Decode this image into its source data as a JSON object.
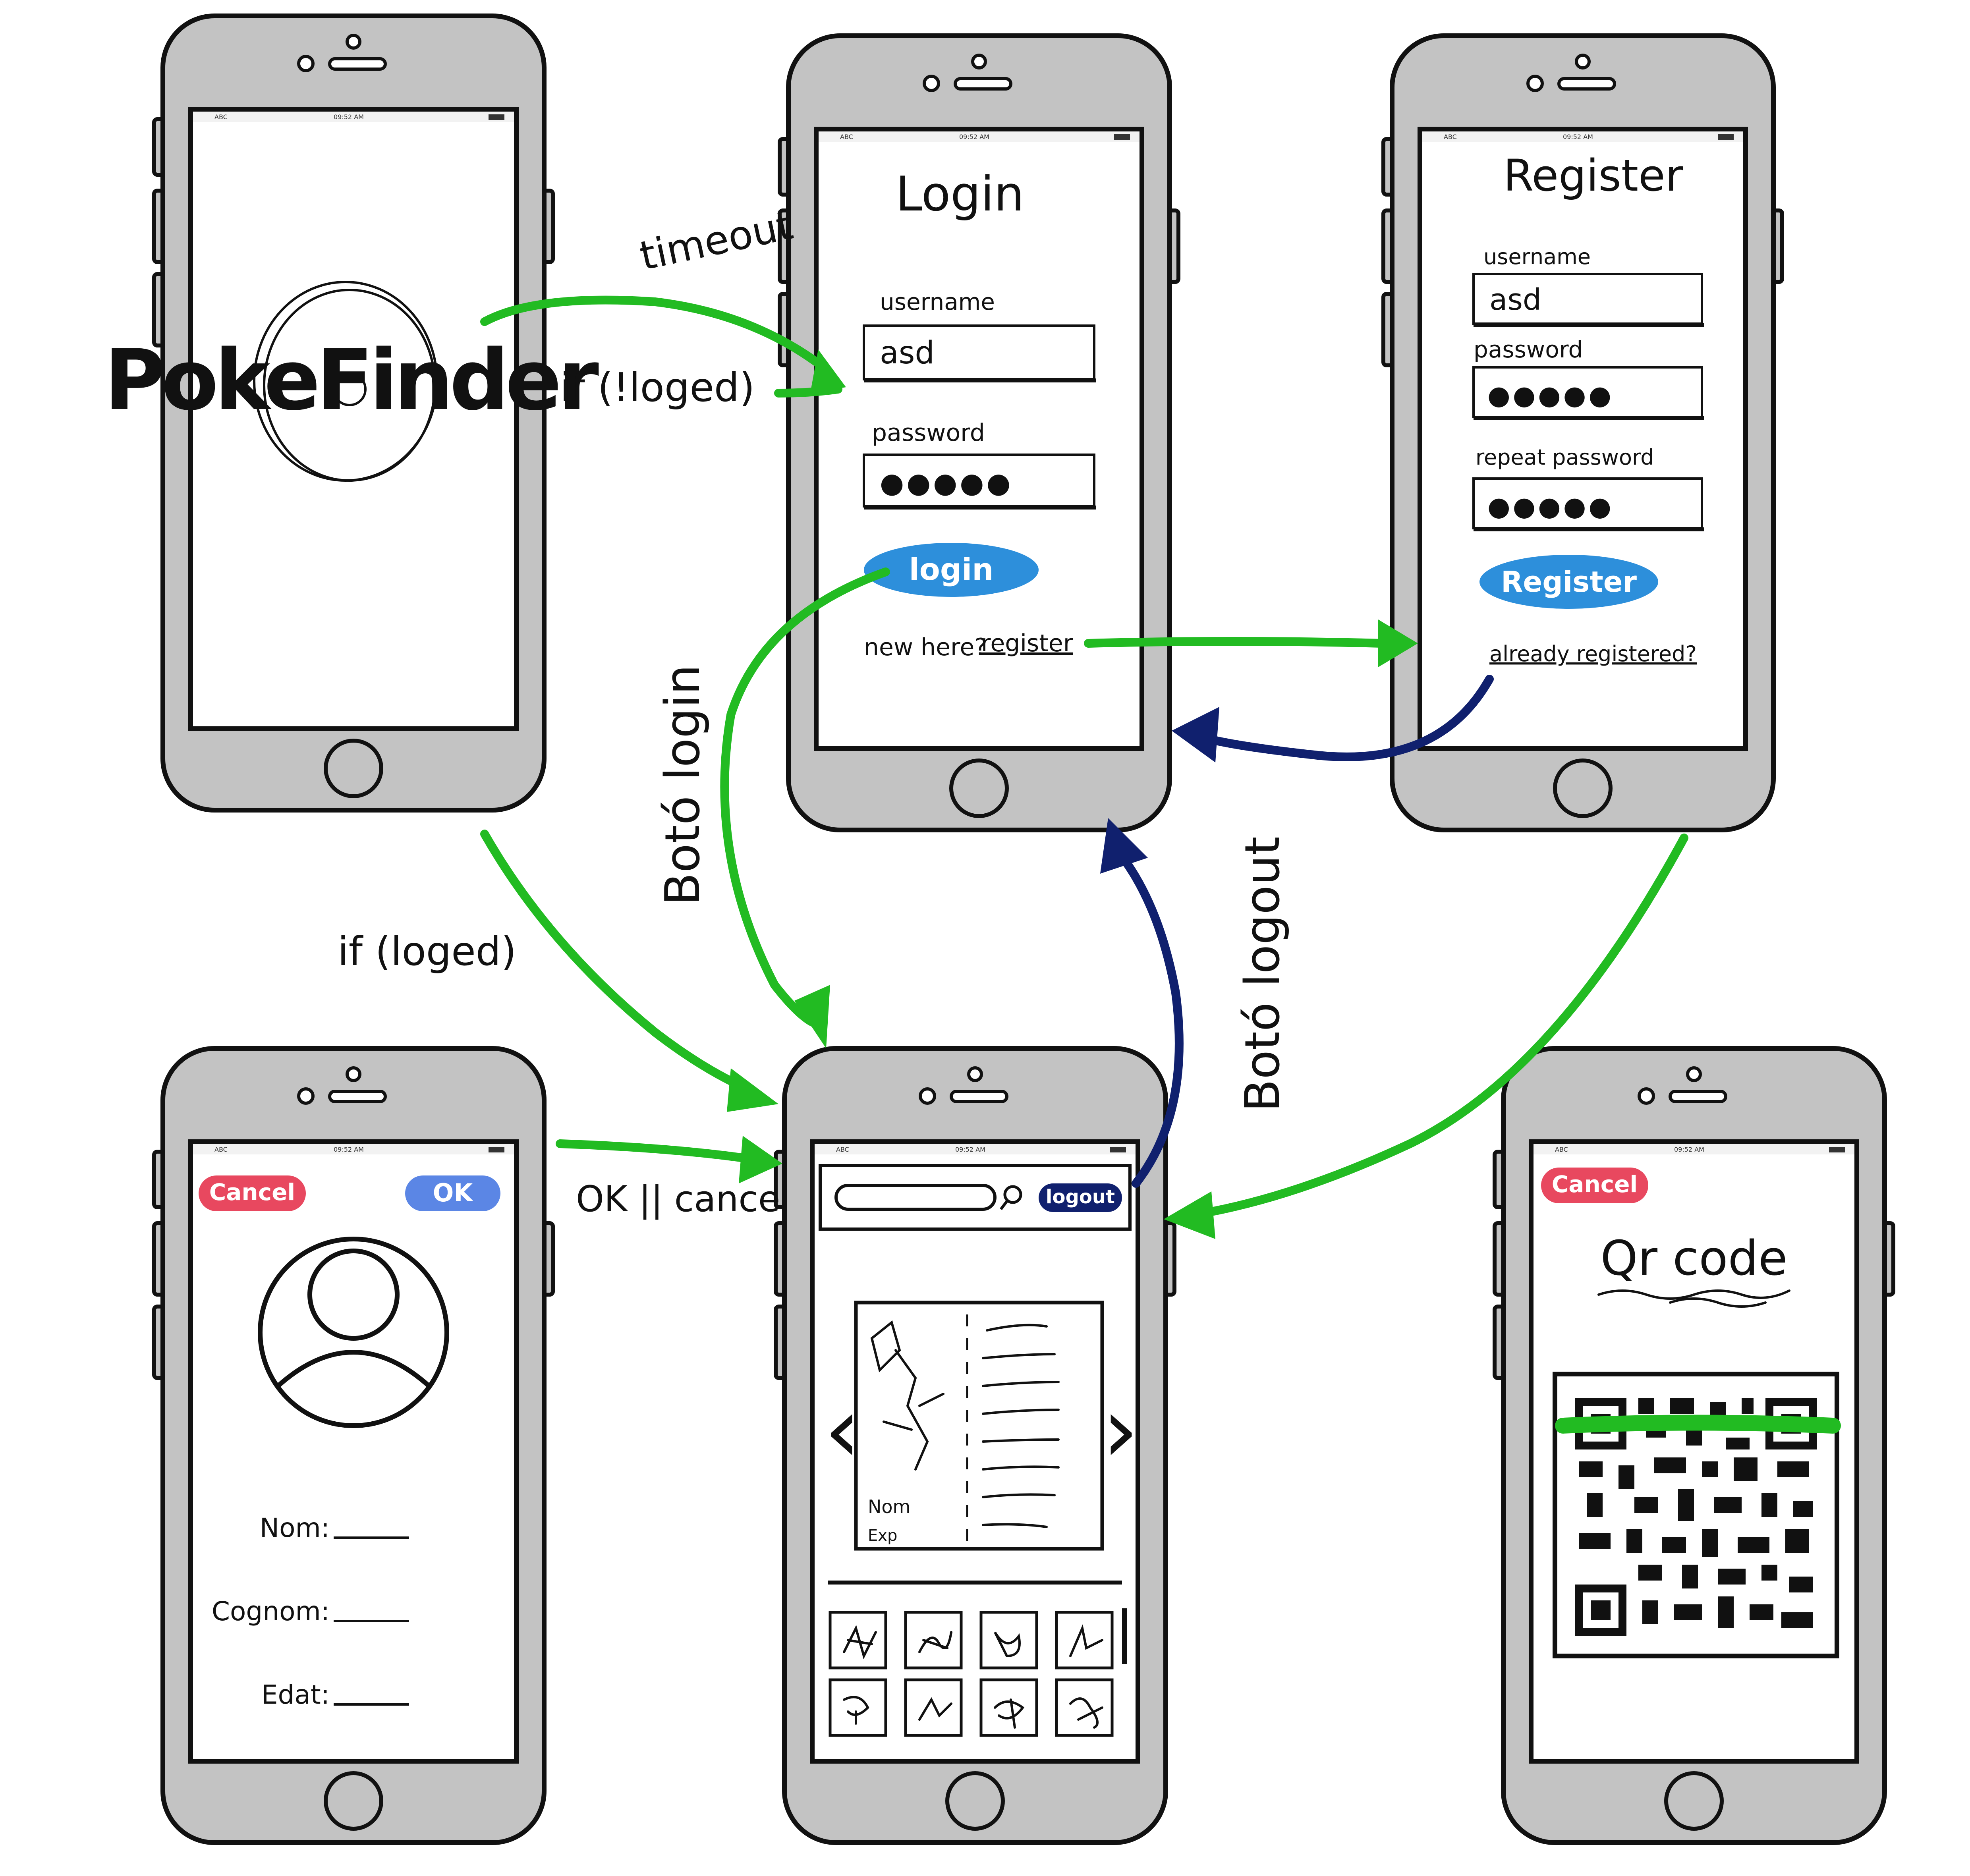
{
  "status_bar": {
    "carrier": "ABC",
    "time": "09:52 AM"
  },
  "splash": {
    "logo": "PokeFinder"
  },
  "login": {
    "title": "Login",
    "username_label": "username",
    "username_value": "asd",
    "password_label": "password",
    "password_value": "●●●●●",
    "button": "login",
    "register_prompt": "new here?",
    "register_link": "register"
  },
  "register": {
    "title": "Register",
    "username_label": "username",
    "username_value": "asd",
    "password_label": "password",
    "password_value": "●●●●●",
    "repeat_label": "repeat password",
    "repeat_value": "●●●●●",
    "button": "Register",
    "login_link": "already registered?"
  },
  "profile": {
    "cancel": "Cancel",
    "ok": "OK",
    "fields": [
      "Nom:",
      "Cognom:",
      "Edat:"
    ]
  },
  "main": {
    "logout": "logout",
    "card_name": "Nom",
    "card_exp": "Exp",
    "prev": "‹",
    "next": "›"
  },
  "qr": {
    "cancel": "Cancel",
    "title": "Qr code"
  },
  "transitions": {
    "timeout": "timeout",
    "not_logged": "if (!loged)",
    "logged": "if (loged)",
    "ok_cancel": "OK || cancel",
    "login_button": "Botó login",
    "logout_button": "Botó logout"
  },
  "colors": {
    "arrow_green": "#22bb22",
    "arrow_navy": "#10206e",
    "login_button": "#2d8fdb",
    "register_button": "#2d8fdb",
    "cancel_button": "#e8485f",
    "ok_button": "#5b86e5",
    "logout_button": "#10206e",
    "scan_line": "#22bb22"
  }
}
